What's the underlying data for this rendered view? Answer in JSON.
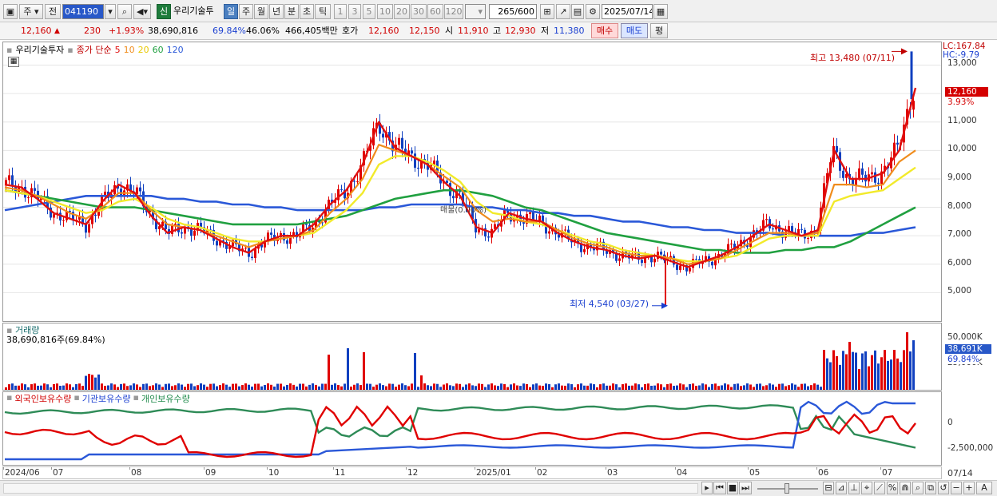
{
  "toolbar": {
    "period_tab": "주",
    "prev_label": "전",
    "stock_code": "041190",
    "stock_name": "우리기술투",
    "new_badge": "신",
    "intervals": [
      "일",
      "주",
      "월",
      "년",
      "분",
      "초",
      "틱"
    ],
    "active_interval": "일",
    "minute_options": [
      "1",
      "3",
      "5",
      "10",
      "20",
      "30",
      "60",
      "120"
    ],
    "count_value": "265",
    "count_total": "/600",
    "date_value": "2025/07/14"
  },
  "quote": {
    "price": "12,160",
    "change": "230",
    "change_pct": "+1.93%",
    "volume": "38,690,816",
    "turnover_ratio": "69.84%",
    "ratio2": "46.06%",
    "amount": "466,405백만",
    "bid_ask_label": "호가",
    "ask": "12,160",
    "bid": "12,150",
    "open_label": "시",
    "open": "11,910",
    "high_label": "고",
    "high": "12,930",
    "low_label": "저",
    "low": "11,380",
    "buy_button": "매수",
    "sell_button": "매도",
    "eval_button": "평"
  },
  "colors": {
    "up": "#e00000",
    "down": "#1040c0",
    "ma5": "#e01010",
    "ma10": "#f08c1c",
    "ma20": "#f2ea2a",
    "ma60": "#20a040",
    "ma120": "#2a58d8"
  },
  "price_panel": {
    "title": "우리기술투자",
    "legend_prefix": "종가 단순",
    "ma_labels": [
      "5",
      "10",
      "20",
      "60",
      "120"
    ],
    "lc_label": "LC:167.84",
    "hc_label": "HC:-9.79",
    "high_annotation": "최고 13,480 (07/11)",
    "low_annotation": "최저 4,540 (03/27)",
    "overlay_label": "매물(0.00%)",
    "current_price_tag": "12,160",
    "current_pct_tag": "3.93%",
    "y_ticks": [
      "13,000",
      "12,000",
      "11,000",
      "10,000",
      "9,000",
      "8,000",
      "7,000",
      "6,000",
      "5,000"
    ]
  },
  "volume_panel": {
    "title": "거래량",
    "value_label": "38,690,816주(69.84%)",
    "y_ticks": [
      "50,000K",
      "25,000K"
    ],
    "current_tag": "38,691K",
    "pct_tag": "69.84%"
  },
  "holdings_panel": {
    "legend": [
      "외국인보유수량",
      "기관보유수량",
      "개인보유수량"
    ],
    "y_ticks": [
      "0",
      "-2,500,000"
    ]
  },
  "x_axis": {
    "labels": [
      "2024/06",
      "07",
      "08",
      "09",
      "10",
      "11",
      "12",
      "2025/01",
      "02",
      "03",
      "04",
      "05",
      "06",
      "07"
    ],
    "right_label": "07/14"
  },
  "chart_data": {
    "type": "line",
    "title": "우리기술투자",
    "series": [
      {
        "name": "5",
        "values": [
          8800,
          8700,
          8300,
          7800,
          7600,
          7400,
          8200,
          8800,
          8500,
          7700,
          7100,
          7300,
          7200,
          6900,
          6600,
          6400,
          6800,
          7000,
          7000,
          7400,
          8100,
          8600,
          9500,
          11000,
          10100,
          9800,
          9500,
          8900,
          8400,
          7300,
          7100,
          7800,
          7600,
          7500,
          7100,
          6800,
          6600,
          6500,
          6300,
          6200,
          6300,
          6100,
          5900,
          6100,
          6300,
          6600,
          7000,
          7400,
          7200,
          7000,
          7200,
          10000,
          9000,
          9000,
          9200,
          10000,
          12200
        ]
      },
      {
        "name": "10",
        "values": [
          8700,
          8600,
          8400,
          8100,
          7800,
          7600,
          8000,
          8500,
          8500,
          7900,
          7400,
          7300,
          7200,
          7000,
          6800,
          6600,
          6800,
          6900,
          7000,
          7200,
          7800,
          8300,
          9000,
          10200,
          10000,
          9800,
          9500,
          9100,
          8700,
          7900,
          7500,
          7600,
          7500,
          7500,
          7200,
          6900,
          6700,
          6600,
          6400,
          6300,
          6300,
          6200,
          6000,
          6100,
          6200,
          6500,
          6800,
          7100,
          7100,
          7000,
          7100,
          8800,
          8800,
          8700,
          8800,
          9600,
          10000
        ]
      },
      {
        "name": "20",
        "values": [
          8600,
          8500,
          8400,
          8200,
          8000,
          7800,
          7900,
          8200,
          8300,
          8000,
          7600,
          7400,
          7300,
          7100,
          6900,
          6800,
          6800,
          6900,
          7000,
          7100,
          7500,
          7900,
          8500,
          9500,
          9800,
          9800,
          9600,
          9300,
          8900,
          8200,
          7800,
          7700,
          7500,
          7400,
          7200,
          7000,
          6800,
          6700,
          6500,
          6400,
          6300,
          6200,
          6100,
          6100,
          6200,
          6300,
          6600,
          6900,
          7000,
          7000,
          7000,
          8200,
          8400,
          8500,
          8600,
          9000,
          9400
        ]
      },
      {
        "name": "60",
        "values": [
          8600,
          8500,
          8400,
          8300,
          8200,
          8100,
          8000,
          8000,
          8000,
          7900,
          7800,
          7700,
          7600,
          7500,
          7400,
          7400,
          7400,
          7400,
          7400,
          7500,
          7600,
          7700,
          7900,
          8100,
          8300,
          8400,
          8500,
          8600,
          8600,
          8500,
          8400,
          8200,
          8000,
          7900,
          7700,
          7500,
          7300,
          7100,
          7000,
          6900,
          6800,
          6700,
          6600,
          6500,
          6500,
          6400,
          6400,
          6400,
          6500,
          6500,
          6600,
          6600,
          6800,
          7100,
          7400,
          7700,
          8000
        ]
      },
      {
        "name": "120",
        "values": [
          7900,
          8000,
          8100,
          8200,
          8300,
          8400,
          8400,
          8400,
          8400,
          8400,
          8300,
          8300,
          8200,
          8200,
          8100,
          8100,
          8000,
          8000,
          7900,
          7900,
          7900,
          7900,
          7900,
          8000,
          8000,
          8100,
          8100,
          8100,
          8100,
          8000,
          8000,
          7900,
          7900,
          7800,
          7800,
          7700,
          7700,
          7600,
          7500,
          7500,
          7400,
          7300,
          7300,
          7200,
          7200,
          7100,
          7100,
          7100,
          7000,
          7000,
          7000,
          7000,
          7000,
          7100,
          7100,
          7200,
          7300
        ]
      }
    ],
    "ylim": [
      4000,
      13800
    ],
    "xlabel": "",
    "ylabel": "",
    "grid": true
  }
}
